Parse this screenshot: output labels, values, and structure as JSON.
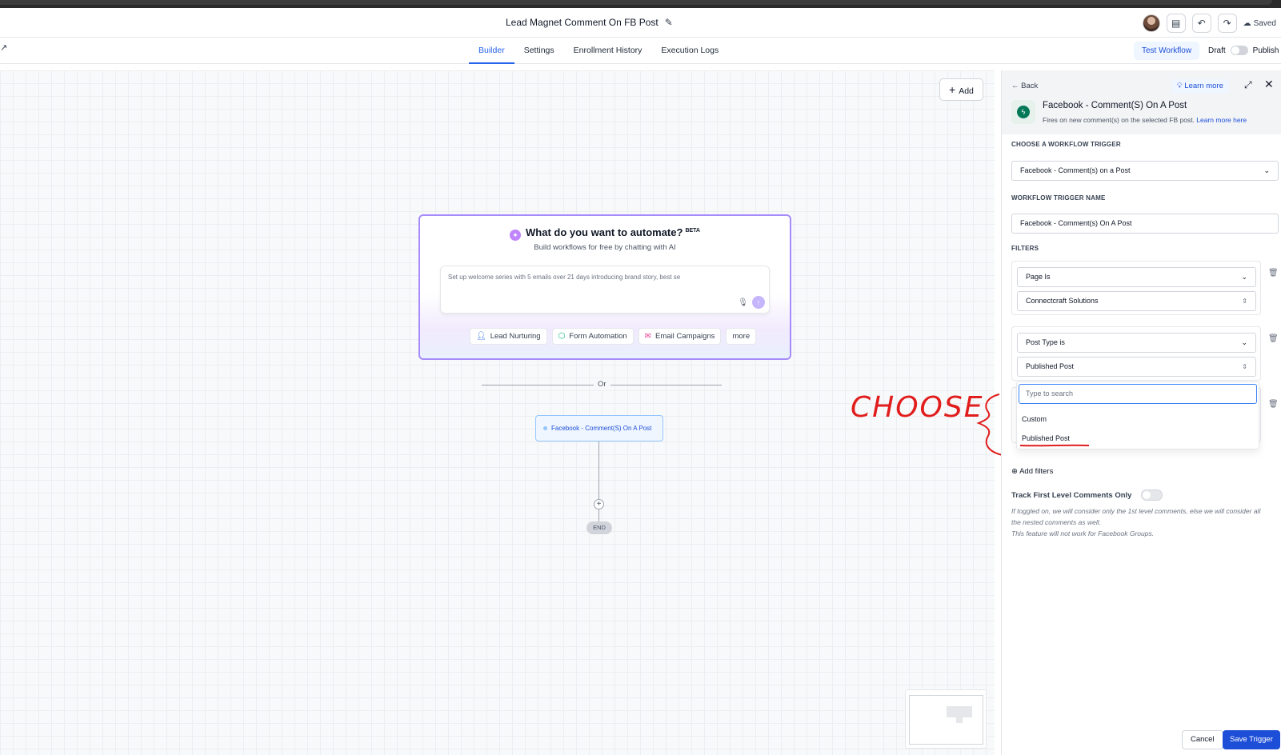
{
  "header": {
    "title": "Lead Magnet Comment On FB Post",
    "saved_label": "Saved"
  },
  "tabs": [
    {
      "label": "Builder",
      "active": true
    },
    {
      "label": "Settings",
      "active": false
    },
    {
      "label": "Enrollment History",
      "active": false
    },
    {
      "label": "Execution Logs",
      "active": false
    }
  ],
  "actions": {
    "test_workflow": "Test Workflow",
    "draft": "Draft",
    "publish": "Publish"
  },
  "canvas": {
    "add_label": "Add",
    "ai": {
      "title": "What do you want to automate?",
      "badge": "BETA",
      "subtitle": "Build workflows for free by chatting with AI",
      "input_text": "Set up welcome series with 5 emails over 21 days introducing brand story, best se",
      "chips": [
        "Lead Nurturing",
        "Form Automation",
        "Email Campaigns",
        "more"
      ]
    },
    "or_label": "Or",
    "trigger_node": "Facebook - Comment(S) On A Post",
    "end_label": "END"
  },
  "annotation": {
    "text": "CHOOSE",
    "color": "#e11d1d"
  },
  "panel": {
    "back_label": "Back",
    "learn_more": "Learn more",
    "title": "Facebook - Comment(S) On A Post",
    "description": "Fires on new comment(s) on the selected FB post.",
    "description_link": "Learn more here",
    "choose_trigger_label": "CHOOSE A WORKFLOW TRIGGER",
    "trigger_value": "Facebook - Comment(s) on a Post",
    "trigger_name_label": "WORKFLOW TRIGGER NAME",
    "trigger_name_value": "Facebook - Comment(s) On A Post",
    "filters_label": "FILTERS",
    "filters": [
      {
        "field": "Page Is",
        "value": "Connectcraft Solutions"
      },
      {
        "field": "Post Type is",
        "value": "Published Post"
      }
    ],
    "dropdown": {
      "search_placeholder": "Type to search",
      "options": [
        "Custom",
        "Published Post"
      ]
    },
    "add_filters": "Add filters",
    "track_label": "Track First Level Comments Only",
    "track_enabled": false,
    "hint_1": "If toggled on, we will consider only the 1st level comments, else we will consider all the nested comments as well.",
    "hint_2": "This feature will not work for Facebook Groups.",
    "cancel": "Cancel",
    "save": "Save Trigger"
  },
  "colors": {
    "primary": "#2563eb",
    "ai_border": "#a78bfa",
    "save_button": "#1d4ed8"
  }
}
